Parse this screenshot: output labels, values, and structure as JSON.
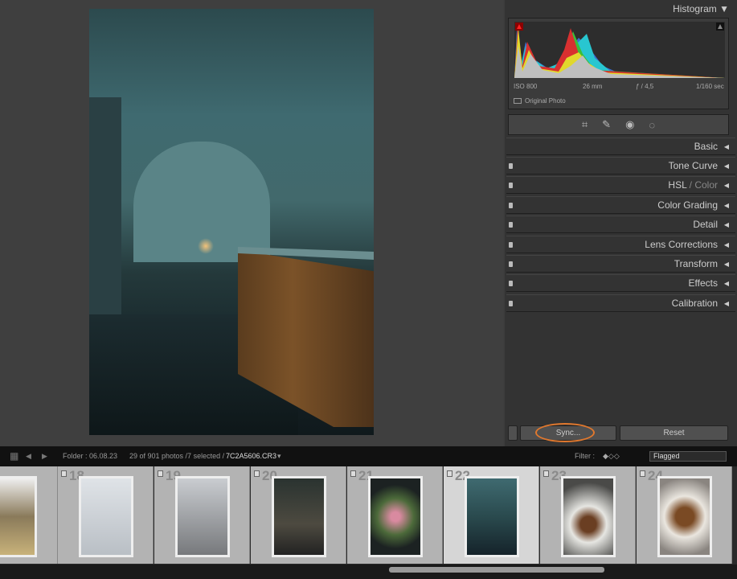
{
  "right_panel": {
    "histogram": {
      "title": "Histogram",
      "iso": "ISO 800",
      "focal": "26 mm",
      "aperture": "ƒ / 4,5",
      "shutter": "1/160 sec",
      "original_photo": "Original Photo"
    },
    "sections": [
      {
        "label": "Basic"
      },
      {
        "label": "Tone Curve"
      },
      {
        "label": "HSL",
        "label2": "/ Color"
      },
      {
        "label": "Color Grading"
      },
      {
        "label": "Detail"
      },
      {
        "label": "Lens Corrections"
      },
      {
        "label": "Transform"
      },
      {
        "label": "Effects"
      },
      {
        "label": "Calibration"
      }
    ],
    "sync_label": "Sync...",
    "reset_label": "Reset",
    "highlight_color": "#e0782e"
  },
  "filmstrip_bar": {
    "folder": "Folder : 06.08.23",
    "count": "29 of 901 photos /7 selected /",
    "filename": "7C2A5606.CR3",
    "filter_label": "Filter :",
    "filter_value": "Flagged"
  },
  "filmstrip": [
    {
      "num": "18"
    },
    {
      "num": "19"
    },
    {
      "num": "20"
    },
    {
      "num": "21"
    },
    {
      "num": "22"
    },
    {
      "num": "23"
    },
    {
      "num": "24"
    }
  ]
}
